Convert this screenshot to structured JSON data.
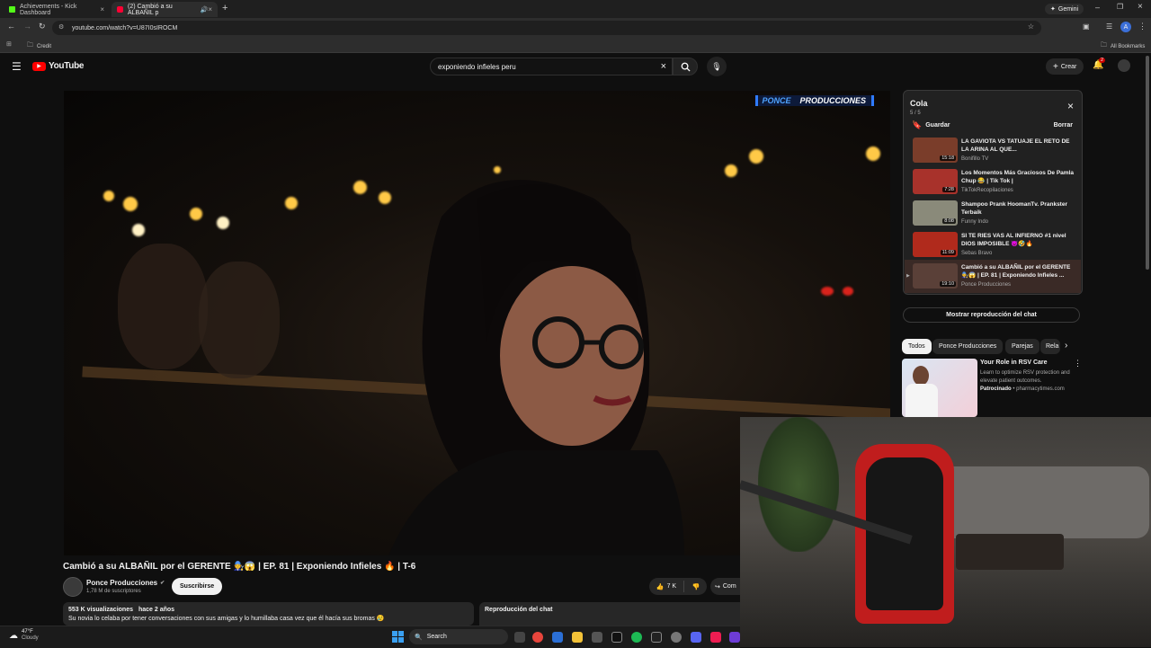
{
  "browser": {
    "tabs": [
      {
        "label": "Achievements - Kick Dashboard",
        "favicon_color": "#53fc18"
      },
      {
        "label": "(2) Cambió a su ALBAÑIL p",
        "favicon_color": "#ff0033"
      }
    ],
    "gemini_label": "Gemini",
    "url": "youtube.com/watch?v=U87I0sIROCM",
    "bookmark_credit": "Credit",
    "bookmark_all": "All Bookmarks",
    "profile_initial": "A"
  },
  "youtube": {
    "logo_text": "YouTube",
    "search_value": "exponiendo infieles peru",
    "create_label": "Crear",
    "notification_count": "2"
  },
  "video": {
    "branding_left": "PONCE",
    "branding_right": "PRODUCCIONES",
    "title": "Cambió a su ALBAÑIL por el GERENTE 🧑‍🔧😱 | EP. 81 | Exponiendo Infieles 🔥 | T-6",
    "channel_name": "Ponce Producciones",
    "subscribers": "1,78 M de suscriptores",
    "subscribe_label": "Suscribirse",
    "likes": "7 K",
    "share_label": "Com",
    "views": "553 K visualizaciones",
    "age": "hace 2 años",
    "description": "Su novia lo celaba por tener conversaciones con sus amigas y lo humillaba casa vez que él hacía sus bromas 😢",
    "chat_replay_title": "Reproducción del chat"
  },
  "queue": {
    "title": "Cola",
    "position": "5 / 5",
    "save_label": "Guardar",
    "clear_label": "Borrar",
    "items": [
      {
        "title": "LA GAVIOTA VS TATUAJE EL RETO DE LA ARINA AL QUE...",
        "channel": "Bonifillo TV",
        "duration": "15:18",
        "color": "#7a3d2a"
      },
      {
        "title": "Los Momentos Más Graciosos De Pamla Chup 😂 | Tik Tok |",
        "channel": "TikTokRecopilaciones",
        "duration": "7:28",
        "color": "#a8322b"
      },
      {
        "title": "Shampoo Prank HoomanTv. Prankster Terbaik",
        "channel": "Funny Indo",
        "duration": "8:08",
        "color": "#8a8a7a"
      },
      {
        "title": "SI TE RIES VAS AL INFIERNO #1 nivel DIOS IMPOSIBLE 😈🤣🔥",
        "channel": "Sebas Bravo",
        "duration": "11:09",
        "color": "#b02a1c"
      },
      {
        "title": "Cambió a su ALBAÑIL por el GERENTE 🧑‍🔧😱 | EP. 81 | Exponiendo Infieles ...",
        "channel": "Ponce Producciones",
        "duration": "19:10",
        "color": "#5a4038"
      }
    ],
    "chat_replay_button": "Mostrar reproducción del chat"
  },
  "chips": [
    "Todos",
    "Ponce Producciones",
    "Parejas",
    "Rela"
  ],
  "ad": {
    "title": "Your Role in RSV Care",
    "description": "Learn to optimize RSV protection and elevate patient outcomes.",
    "sponsored": "Patrocinado",
    "domain": "pharmacytimes.com"
  },
  "taskbar": {
    "weather_temp": "47°F",
    "weather_desc": "Cloudy",
    "search_label": "Search"
  }
}
